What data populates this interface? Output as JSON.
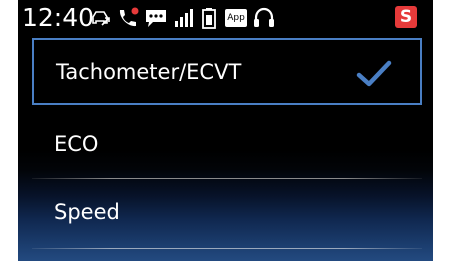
{
  "status_bar": {
    "time": "12:40",
    "icons": [
      "drive-mode-icon",
      "phone-missed-call-icon",
      "message-icon",
      "signal-strength-icon",
      "battery-icon",
      "app-icon",
      "headset-icon"
    ],
    "app_label": "App",
    "badge_label": "S",
    "badge_color": "#e63a3a"
  },
  "menu": {
    "items": [
      {
        "label": "Tachometer/ECVT",
        "selected": true
      },
      {
        "label": "ECO",
        "selected": false
      },
      {
        "label": "Speed",
        "selected": false
      }
    ],
    "selection_color": "#4a7fc4",
    "checkmark_color": "#4a7fc4"
  }
}
